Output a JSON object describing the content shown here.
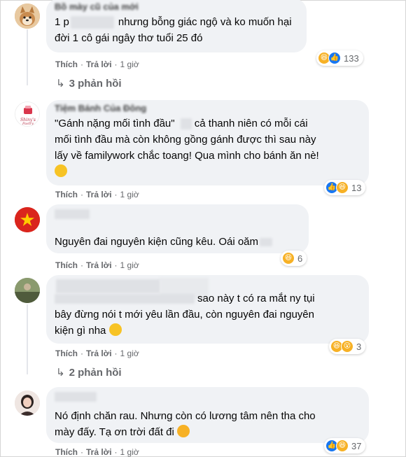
{
  "comments": [
    {
      "text_after": "nhưng bỗng giác ngộ và ko muốn hại đời 1 cô gái ngây thơ tuổi 25 đó",
      "text_prefix": "1 p",
      "author": "Bồ mày cũ của mới",
      "actions": {
        "like": "Thích",
        "reply": "Trả lời",
        "time": "1 giờ"
      },
      "reaction_count": "133",
      "reactions": [
        "haha-icon",
        "like-icon"
      ]
    },
    {
      "author": "Tiệm Bánh Của Đông",
      "avatar_text": "Shiny's Pastry",
      "line1_a": "\"Gánh nặng mối tình đầu\"",
      "line1_b": "cả thanh niên có mỗi cái",
      "line2": "mối tình đầu mà còn không gồng gánh được thì sau này",
      "line3": "lấy về familywork chắc toang! Qua mình cho bánh ăn nè!",
      "actions": {
        "like": "Thích",
        "reply": "Trả lời",
        "time": "1 giờ"
      },
      "reaction_count": "13",
      "reactions": [
        "like-icon",
        "haha-icon"
      ]
    },
    {
      "text": "Nguyên đai nguyên kiện cũng kêu. Oái oăm",
      "actions": {
        "like": "Thích",
        "reply": "Trả lời",
        "time": "1 giờ"
      },
      "reaction_count": "6",
      "reactions": [
        "haha-icon"
      ]
    },
    {
      "line1_end": "sao này t có ra mắt ny tụi",
      "line2": "bây đừng nói t mới yêu lần đầu, còn nguyên đai nguyên",
      "line3": "kiện gì nha",
      "actions": {
        "like": "Thích",
        "reply": "Trả lời",
        "time": "1 giờ"
      },
      "reaction_count": "3",
      "reactions": [
        "haha-icon",
        "wow-icon"
      ]
    },
    {
      "line1": "Nó định chăn rau. Nhưng còn có lương tâm nên tha cho",
      "line2": "mày đấy. Tạ ơn trời đất đi",
      "actions": {
        "like": "Thích",
        "reply": "Trả lời",
        "time": "1 giờ"
      },
      "reaction_count": "37",
      "reactions": [
        "like-icon",
        "haha-icon"
      ]
    }
  ],
  "reply_links": {
    "first": "3 phản hồi",
    "second": "2 phản hồi"
  },
  "colors": {
    "bubble": "#f0f2f5",
    "secondary_text": "#65676b",
    "like_blue": "#1877f2",
    "haha_yellow": "#f7b125",
    "love_red": "#f33e58"
  }
}
